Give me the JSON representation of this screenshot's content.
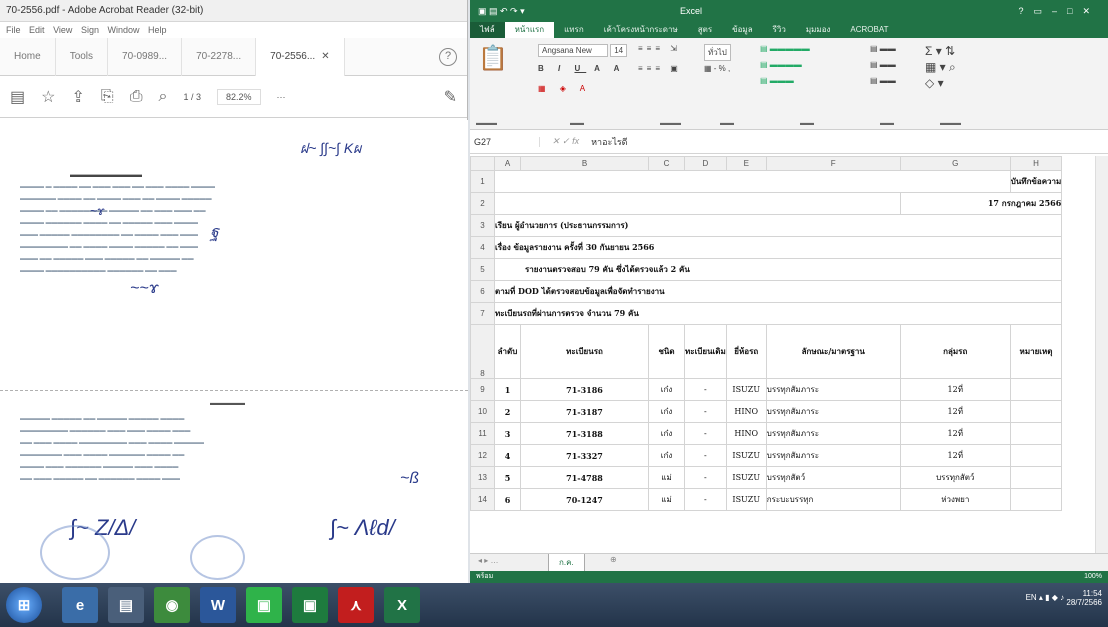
{
  "acrobat": {
    "window_title": "70-2556.pdf - Adobe Acrobat Reader (32-bit)",
    "menu": [
      "File",
      "Edit",
      "View",
      "Sign",
      "Window",
      "Help"
    ],
    "tabs": [
      {
        "label": "Home"
      },
      {
        "label": "Tools"
      },
      {
        "label": "70-0989..."
      },
      {
        "label": "70-2278..."
      },
      {
        "label": "70-2556..."
      }
    ],
    "page_indicator": "1 / 3",
    "zoom": "82.2%",
    "more": "···"
  },
  "excel": {
    "window_title": "Excel",
    "ribbon_tabs": [
      "ไฟล์",
      "หน้าแรก",
      "แทรก",
      "เค้าโครงหน้ากระดาษ",
      "สูตร",
      "ข้อมูล",
      "รีวิว",
      "มุมมอง",
      "ACROBAT"
    ],
    "font_name": "Angsana New",
    "font_size": "14",
    "number_format": "ทั่วไป",
    "name_box": "G27",
    "formula_value": "หาอะไรดี",
    "columns": [
      "A",
      "B",
      "C",
      "D",
      "E",
      "F",
      "G",
      "H"
    ],
    "row1_text": "บันทึกข้อความ",
    "row2_text": "17 กรกฎาคม 2566",
    "row3_text": "เรียน ผู้อำนวยการ (ประธานกรรมการ)",
    "row4_text": "เรื่อง ข้อมูลรายงาน ครั้งที่ 30 กันยายน 2566",
    "row5_text": "รายงานตรวจสอบ 79 คัน ซึ่งได้ตรวจแล้ว 2 คัน",
    "row6_text": "ตามที่ DOD ได้ตรวจสอบข้อมูลเพื่อจัดทำรายงาน",
    "row7_text": "ทะเบียนรถที่ผ่านการตรวจ จำนวน 79 คัน",
    "table_headers": [
      "ลำดับ",
      "ทะเบียนรถ",
      "ชนิด",
      "ทะเบียนเดิม",
      "ยี่ห้อรถ",
      "ลักษณะ/มาตรฐาน",
      "กลุ่มรถ",
      "หมายเหตุ"
    ],
    "rows": [
      {
        "rn": "9",
        "no": "1",
        "plate": "71-3186",
        "type": "เก๋ง",
        "old": "-",
        "brand": "ISUZU",
        "desc": "บรรทุกสัมภาระ",
        "group": "12ที่"
      },
      {
        "rn": "10",
        "no": "2",
        "plate": "71-3187",
        "type": "เก๋ง",
        "old": "-",
        "brand": "HINO",
        "desc": "บรรทุกสัมภาระ",
        "group": "12ที่"
      },
      {
        "rn": "11",
        "no": "3",
        "plate": "71-3188",
        "type": "เก๋ง",
        "old": "-",
        "brand": "HINO",
        "desc": "บรรทุกสัมภาระ",
        "group": "12ที่"
      },
      {
        "rn": "12",
        "no": "4",
        "plate": "71-3327",
        "type": "เก๋ง",
        "old": "-",
        "brand": "ISUZU",
        "desc": "บรรทุกสัมภาระ",
        "group": "12ที่"
      },
      {
        "rn": "13",
        "no": "5",
        "plate": "71-4788",
        "type": "แม่",
        "old": "-",
        "brand": "ISUZU",
        "desc": "บรรทุกสัตว์",
        "group": "บรรทุกสัตว์"
      },
      {
        "rn": "14",
        "no": "6",
        "plate": "70-1247",
        "type": "แม่",
        "old": "-",
        "brand": "ISUZU",
        "desc": "กระบะบรรทุก",
        "group": "ห่วงพยา"
      }
    ],
    "sheet_tab": "ก.ค.",
    "status_text": "พร้อม",
    "zoom": "100%"
  },
  "tray": {
    "time": "11:54",
    "date": "28/7/2566",
    "lang": "EN"
  }
}
